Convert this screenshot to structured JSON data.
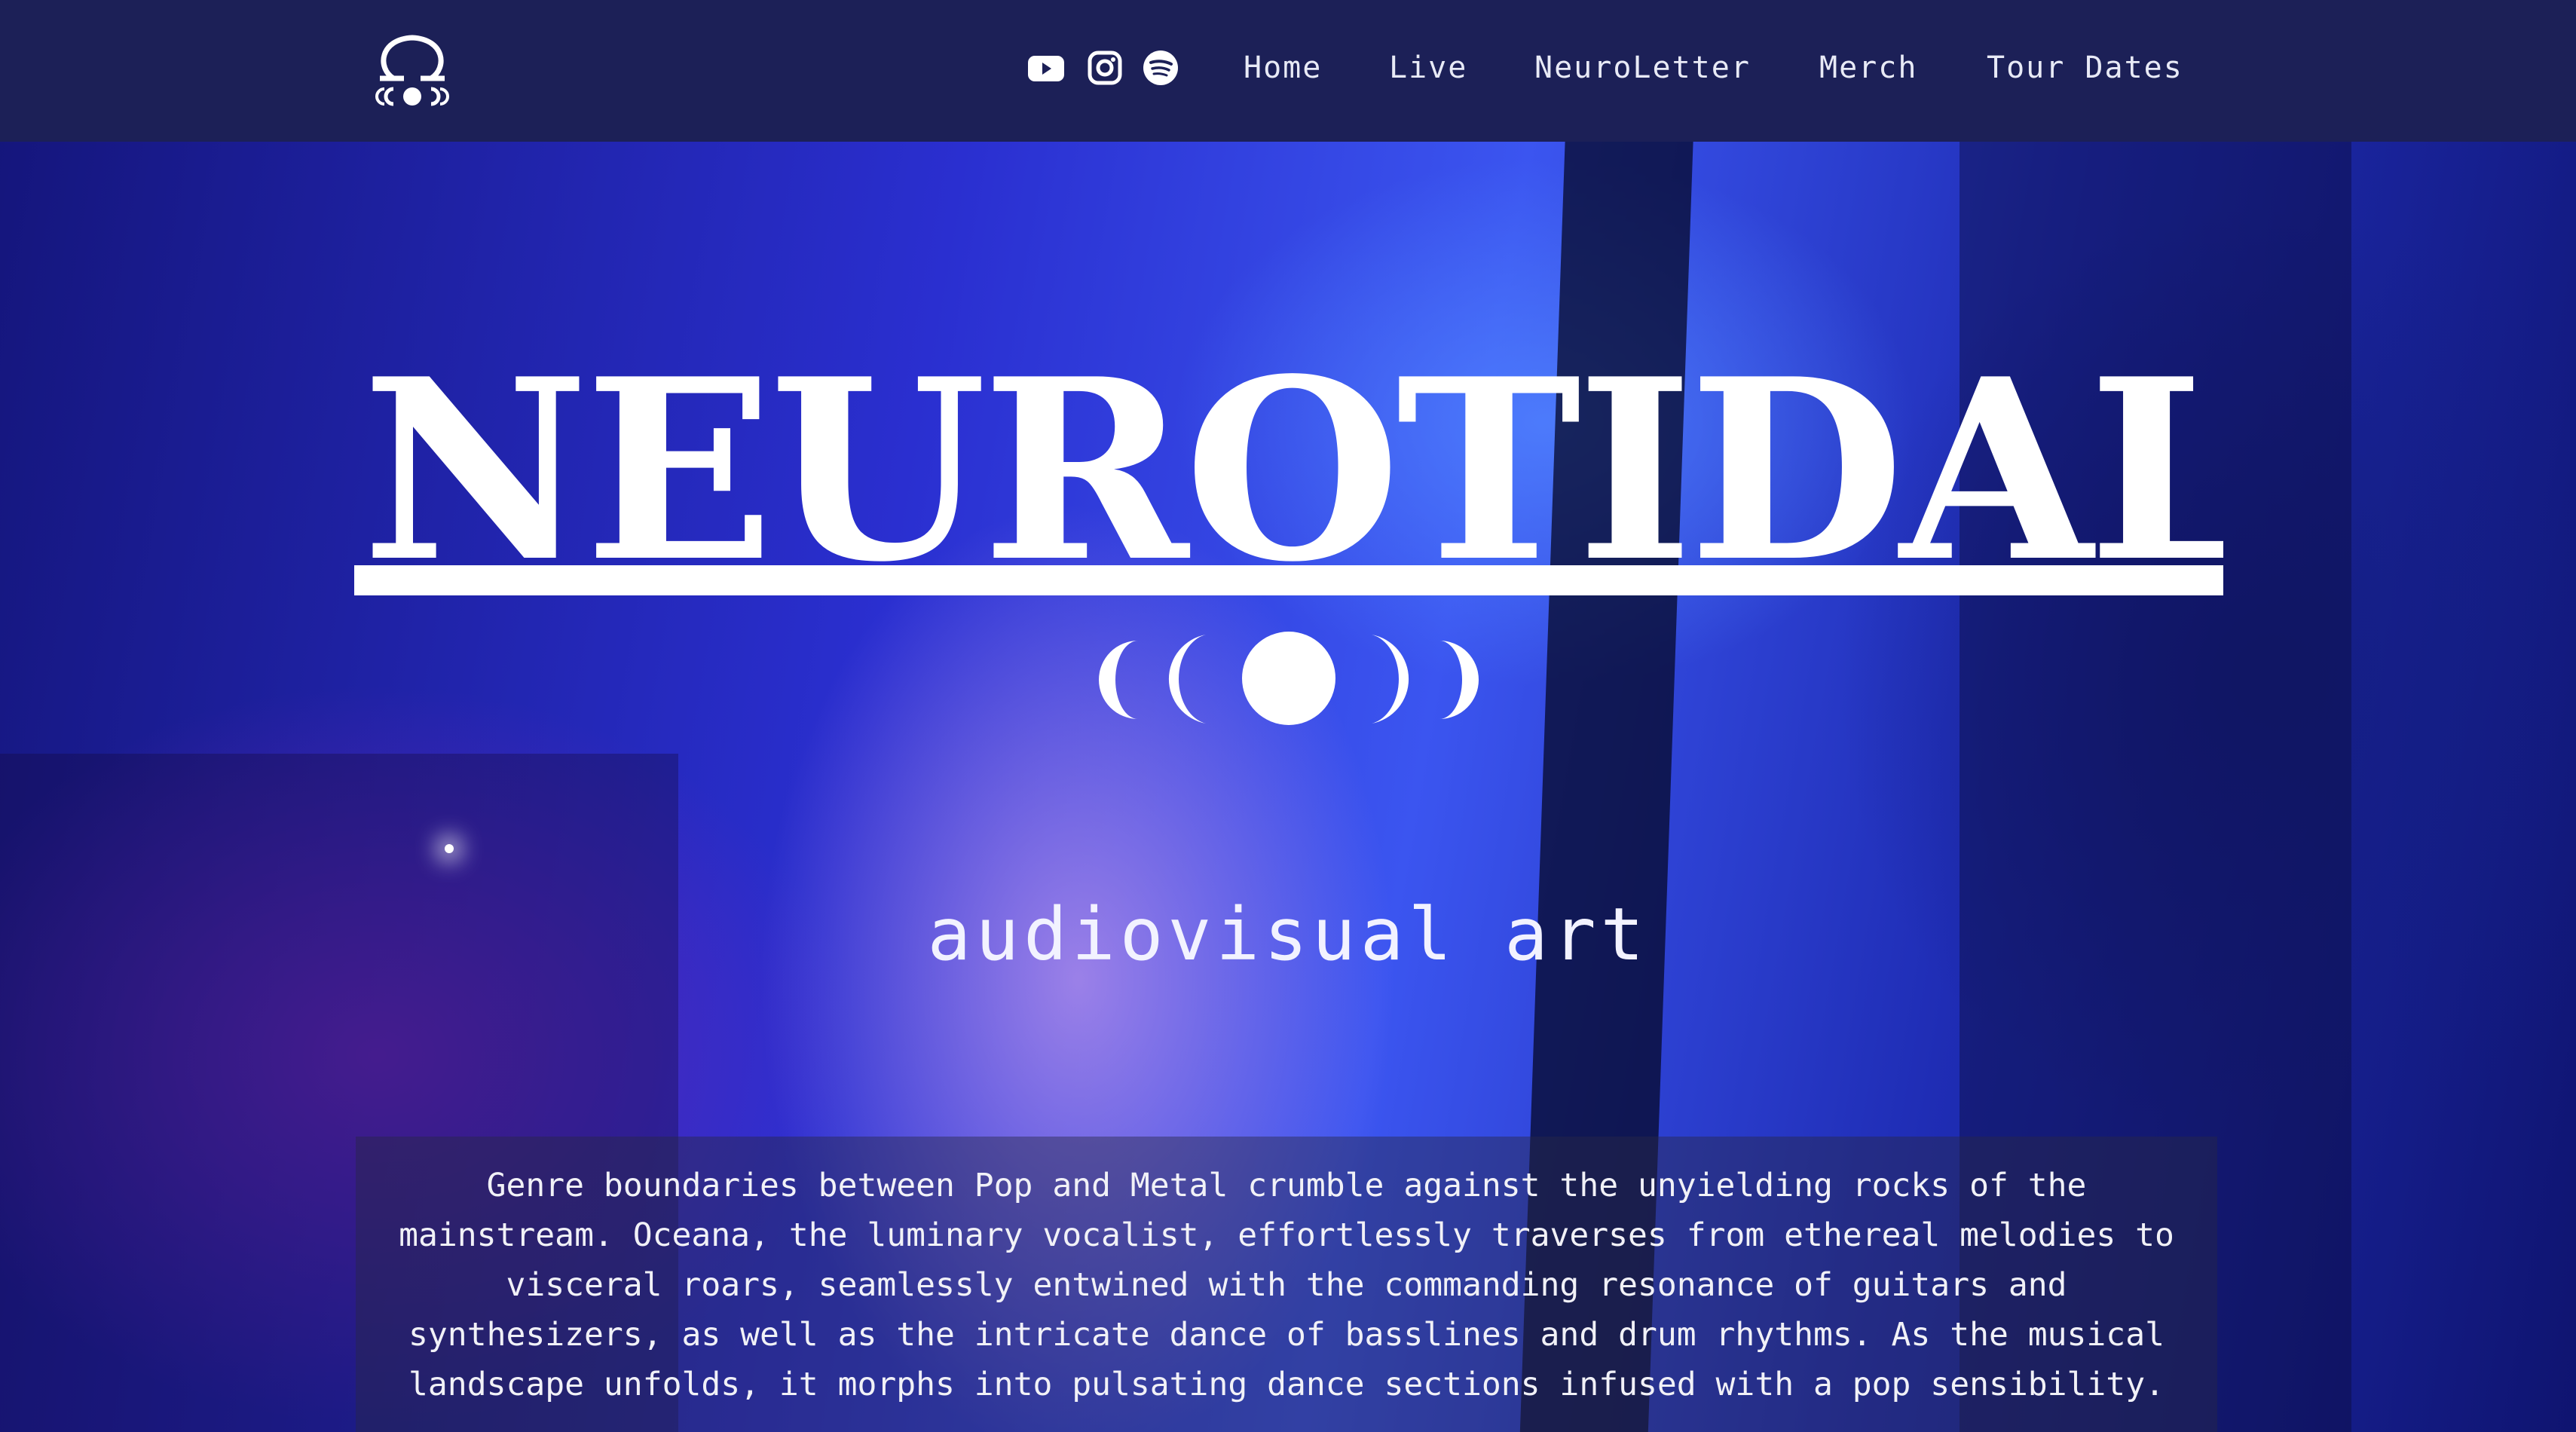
{
  "brand": {
    "logo_text": "NEUROTIDAL",
    "tagline": "audiovisual art"
  },
  "nav": {
    "social_icons": [
      "youtube-icon",
      "instagram-icon",
      "spotify-icon"
    ],
    "links": [
      "Home",
      "Live",
      "NeuroLetter",
      "Merch",
      "Tour Dates"
    ]
  },
  "hero": {
    "description": "Genre boundaries between Pop and Metal crumble against the unyielding rocks of the mainstream. Oceana, the luminary vocalist, effortlessly traverses from ethereal melodies to visceral roars, seamlessly entwined with the commanding resonance of guitars and synthesizers, as well as the intricate dance of basslines and drum rhythms. As the musical landscape unfolds, it morphs into pulsating dance sections infused with a pop sensibility."
  },
  "colors": {
    "nav_bg": "#1c2057",
    "hero_blue": "#2a3ae0",
    "text": "#ffffff"
  }
}
